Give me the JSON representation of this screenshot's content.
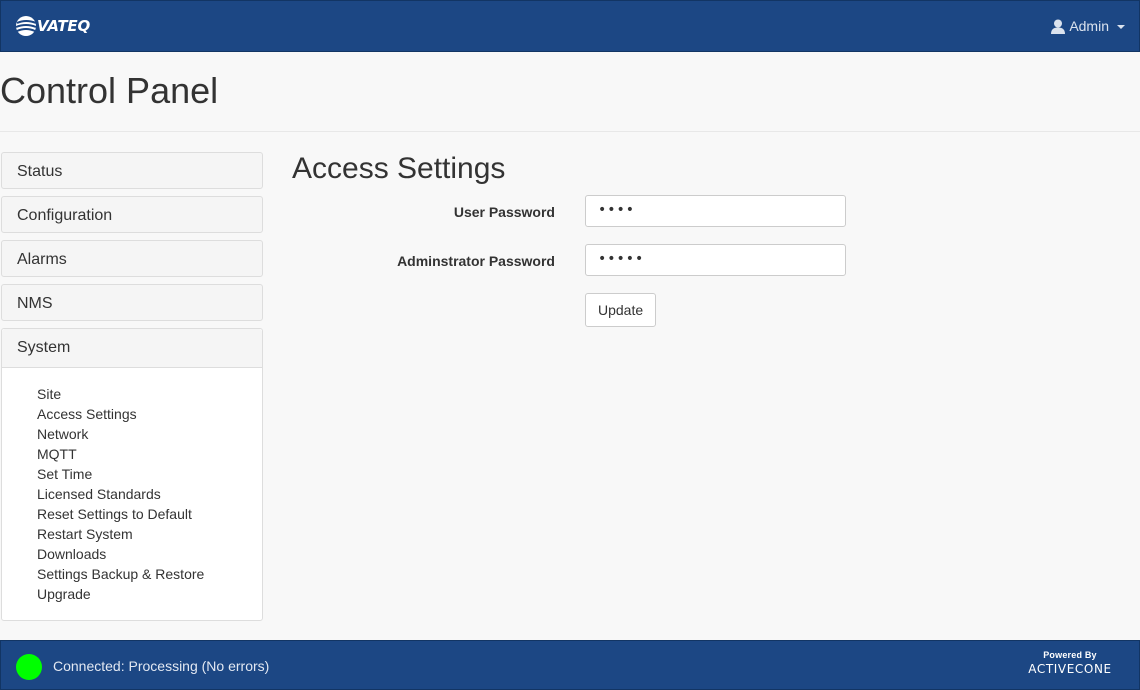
{
  "header": {
    "logo_text": "VATEQ",
    "user_menu_label": "Admin"
  },
  "page": {
    "title": "Control Panel"
  },
  "sidebar": {
    "panels": [
      {
        "label": "Status"
      },
      {
        "label": "Configuration"
      },
      {
        "label": "Alarms"
      },
      {
        "label": "NMS"
      },
      {
        "label": "System"
      }
    ],
    "system_items": [
      "Site",
      "Access Settings",
      "Network",
      "MQTT",
      "Set Time",
      "Licensed Standards",
      "Reset Settings to Default",
      "Restart System",
      "Downloads",
      "Settings Backup & Restore",
      "Upgrade"
    ]
  },
  "main": {
    "heading": "Access Settings",
    "user_password_label": "User Password",
    "user_password_value": "••••",
    "admin_password_label": "Adminstrator Password",
    "admin_password_value": "•••••",
    "update_button": "Update"
  },
  "footer": {
    "status_color": "#00ff00",
    "status_text": "Connected: Processing (No errors)",
    "powered_by": "Powered By",
    "powered_brand": "ACTIVECONE"
  },
  "colors": {
    "navbar": "#1c4784",
    "background": "#f8f8f8"
  }
}
